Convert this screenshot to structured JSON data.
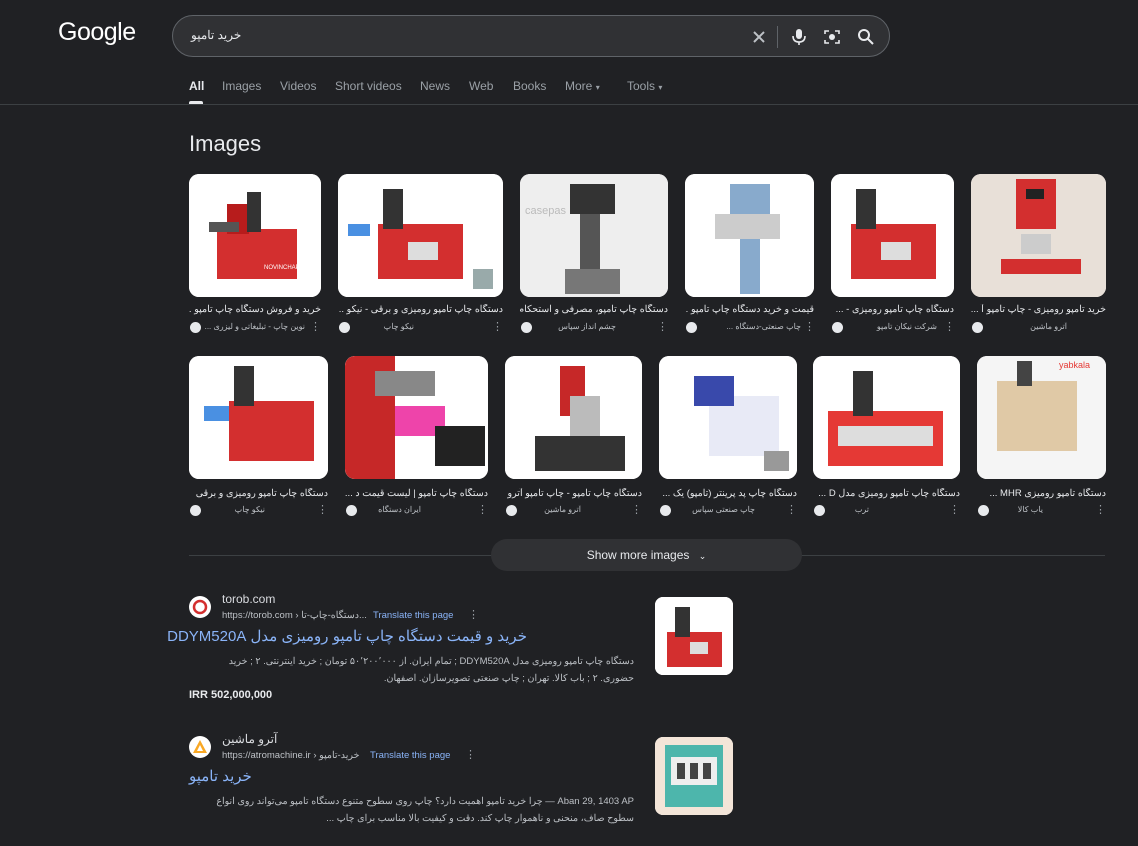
{
  "header": {
    "logo": "Google",
    "query": "خرید تامپو"
  },
  "tabs": [
    "All",
    "Images",
    "Videos",
    "Short videos",
    "News",
    "Web",
    "Books",
    "More",
    "Tools"
  ],
  "images_section": {
    "title": "Images",
    "row1": [
      {
        "caption": "خرید و فروش دستگاه چاپ تامپو ...",
        "source": "نوین چاپ - تبلیغاتی و لیزری ..."
      },
      {
        "caption": "دستگاه چاپ تامپو رومیزی و برقی - نیکو ...",
        "source": "نیکو چاپ"
      },
      {
        "caption": "دستگاه چاپ تامپو، مصرفی و استحکام ...",
        "source": "چشم انداز سپاس"
      },
      {
        "caption": "قیمت و خرید دستگاه چاپ تامپو ...",
        "source": "چاپ صنعتی-دستگاه ..."
      },
      {
        "caption": "دستگاه چاپ تامپو رومیزی - ...",
        "source": "شرکت نیکان تامپو"
      },
      {
        "caption": "خرید تامپو رومیزی - چاپ تامپو آ ...",
        "source": "آترو ماشین"
      }
    ],
    "row2": [
      {
        "caption": "دستگاه چاپ تامپو رومیزی و برقی",
        "source": "نیکو چاپ"
      },
      {
        "caption": "دستگاه چاپ تامپو | لیست قیمت د ...",
        "source": "ایران دستگاه"
      },
      {
        "caption": "دستگاه چاپ تامپو - چاپ تامپو آترو ما ...",
        "source": "آترو ماشین"
      },
      {
        "caption": "دستگاه چاپ پد پرینتر (تامپو) یک ...",
        "source": "چاپ صنعتی سپاس"
      },
      {
        "caption": "دستگاه چاپ تامپو رومیزی مدل D ...",
        "source": "ترب"
      },
      {
        "caption": "دستگاه تامپو رومیزی MHR ...",
        "source": "یاب کالا"
      }
    ],
    "show_more": "Show more images"
  },
  "results": [
    {
      "site": "torob.com",
      "url": "https://torob.com › دستگاه-چاپ-تا...",
      "translate": "Translate this page",
      "title": "خرید و قیمت دستگاه چاپ تامپو رومیزی مدل DDYM520A",
      "snippet_1": "دستگاه چاپ تامپو رومیزی مدل DDYM520A ; تمام ایران. از ۵۰٬۲۰۰٬۰۰۰ تومان ; خرید اینترنتی. ۲ ; خرید",
      "snippet_2": "حضوری. ۲ ; باب کالا. تهران ; چاپ صنعتی تصویرسازان. اصفهان.",
      "price": "IRR 502,000,000"
    },
    {
      "site": "آترو ماشین",
      "url": "https://atromachine.ir › خرید-تامپو",
      "translate": "Translate this page",
      "title": "خرید تامپو",
      "snippet_1": "Aban 29, 1403 AP — چرا خرید تامپو اهمیت دارد؟ چاپ روی سطوح متنوع دستگاه تامپو می‌تواند روی انواع",
      "snippet_2": "سطوح صاف، منحنی و ناهموار چاپ کند. دقت و کیفیت بالا مناسب برای چاپ ..."
    }
  ],
  "colors": {
    "background": "#202124",
    "link": "#8ab4f8",
    "machine_red": "#d32f2f"
  }
}
